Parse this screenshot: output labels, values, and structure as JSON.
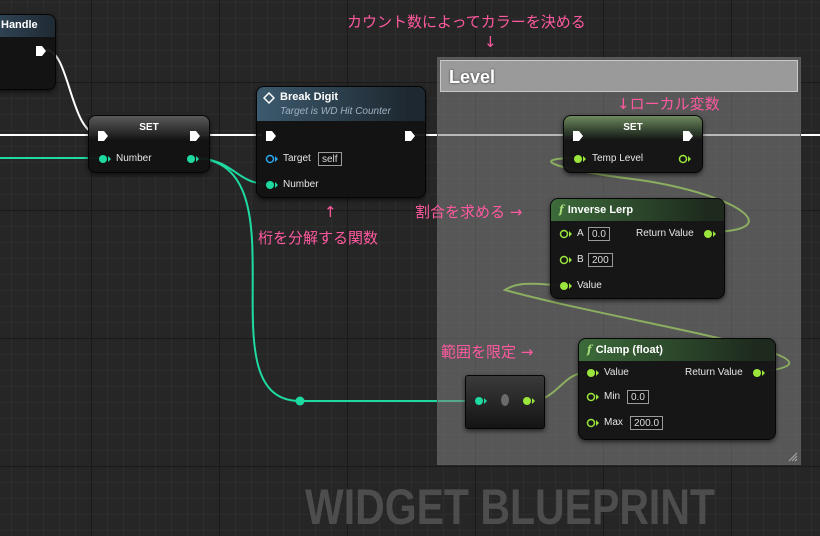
{
  "annotations": {
    "count_color": "カウント数によってカラーを決める",
    "count_color_arrow": "↓",
    "local_var": "↓ローカル変数",
    "break_digit_up": "↑",
    "break_digit": "桁を分解する関数",
    "ratio": "割合を求める →",
    "range": "範囲を限定 →"
  },
  "comment_box": {
    "title": "Level"
  },
  "nodes": {
    "handle": {
      "title": "Handle"
    },
    "set_number": {
      "title": "SET",
      "pin": "Number"
    },
    "break_digit": {
      "title": "Break Digit",
      "subtitle": "Target is WD Hit Counter",
      "target_label": "Target",
      "target_value": "self",
      "number_label": "Number"
    },
    "set_temp": {
      "title": "SET",
      "pin": "Temp Level"
    },
    "inverse_lerp": {
      "icon": "f",
      "title": "Inverse Lerp",
      "a_label": "A",
      "a_value": "0.0",
      "b_label": "B",
      "b_value": "200",
      "value_label": "Value",
      "return_label": "Return Value"
    },
    "clamp": {
      "icon": "f",
      "title": "Clamp (float)",
      "value_label": "Value",
      "min_label": "Min",
      "min_value": "0.0",
      "max_label": "Max",
      "max_value": "200.0",
      "return_label": "Return Value"
    }
  },
  "watermark": "WIDGET BLUEPRINT",
  "colors": {
    "annotation": "#ff59a0",
    "int_pin": "#1ed9a0",
    "float_pin": "#9be63c",
    "object_pin": "#2aa7ee",
    "exec_pin": "#ffffff",
    "function_header": "#3c6b3a",
    "break_digit_header": "#3c5a6e"
  }
}
